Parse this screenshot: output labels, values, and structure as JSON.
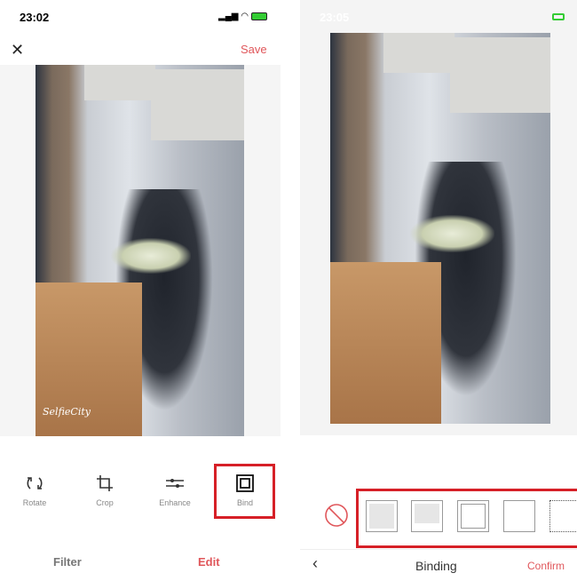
{
  "left": {
    "status": {
      "time": "23:02"
    },
    "header": {
      "close_icon": "close-icon",
      "save_label": "Save"
    },
    "watermark": "SelfieCity",
    "tools": [
      {
        "label": "Rotate",
        "icon": "rotate-icon"
      },
      {
        "label": "Crop",
        "icon": "crop-icon"
      },
      {
        "label": "Enhance",
        "icon": "sliders-icon"
      },
      {
        "label": "Bind",
        "icon": "frame-icon"
      }
    ],
    "tabs": [
      {
        "label": "Filter"
      },
      {
        "label": "Edit",
        "active": true
      }
    ]
  },
  "right": {
    "status": {
      "time": "23:05"
    },
    "frames": [
      "none",
      "gray-fill",
      "gray-top",
      "double-border",
      "plain-border",
      "dotted-border"
    ],
    "footer": {
      "back_icon": "chevron-left-icon",
      "title": "Binding",
      "confirm_label": "Confirm"
    }
  },
  "colors": {
    "accent": "#e0575b",
    "highlight": "#d62027"
  }
}
